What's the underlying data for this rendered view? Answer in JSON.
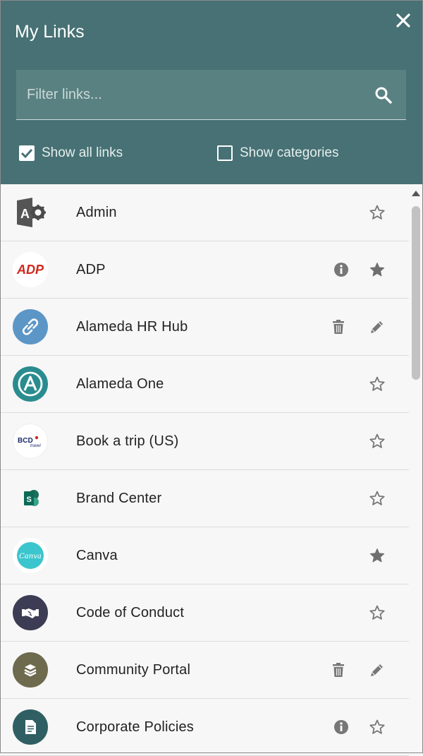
{
  "header": {
    "title": "My Links",
    "close_icon": "close-icon",
    "background": "#477174"
  },
  "filter": {
    "placeholder": "Filter links...",
    "value": "",
    "icon": "search-icon"
  },
  "options": {
    "show_all": {
      "label": "Show all links",
      "checked": true
    },
    "show_categories": {
      "label": "Show categories",
      "checked": false
    }
  },
  "links": [
    {
      "name": "Admin",
      "icon": "access-gear-icon",
      "actions": [
        "star-outline"
      ]
    },
    {
      "name": "ADP",
      "icon": "adp-logo",
      "actions": [
        "info",
        "star-filled"
      ]
    },
    {
      "name": "Alameda HR Hub",
      "icon": "link-icon",
      "actions": [
        "delete",
        "edit"
      ]
    },
    {
      "name": "Alameda One",
      "icon": "alameda-one-logo",
      "actions": [
        "star-outline"
      ]
    },
    {
      "name": "Book a trip (US)",
      "icon": "bcd-travel-logo",
      "actions": [
        "star-outline"
      ]
    },
    {
      "name": "Brand Center",
      "icon": "sharepoint-icon",
      "actions": [
        "star-outline"
      ]
    },
    {
      "name": "Canva",
      "icon": "canva-logo",
      "actions": [
        "star-filled"
      ]
    },
    {
      "name": "Code of Conduct",
      "icon": "handshake-icon",
      "actions": [
        "star-outline"
      ]
    },
    {
      "name": "Community Portal",
      "icon": "layers-icon",
      "actions": [
        "delete",
        "edit"
      ]
    },
    {
      "name": "Corporate Policies",
      "icon": "document-icon",
      "actions": [
        "info",
        "star-outline"
      ]
    }
  ],
  "logo_text": {
    "adp": "ADP",
    "bcd": "BCD",
    "bcd_sub": "travel",
    "canva": "Canva",
    "admin_letter": "A",
    "sp_letter": "S"
  }
}
